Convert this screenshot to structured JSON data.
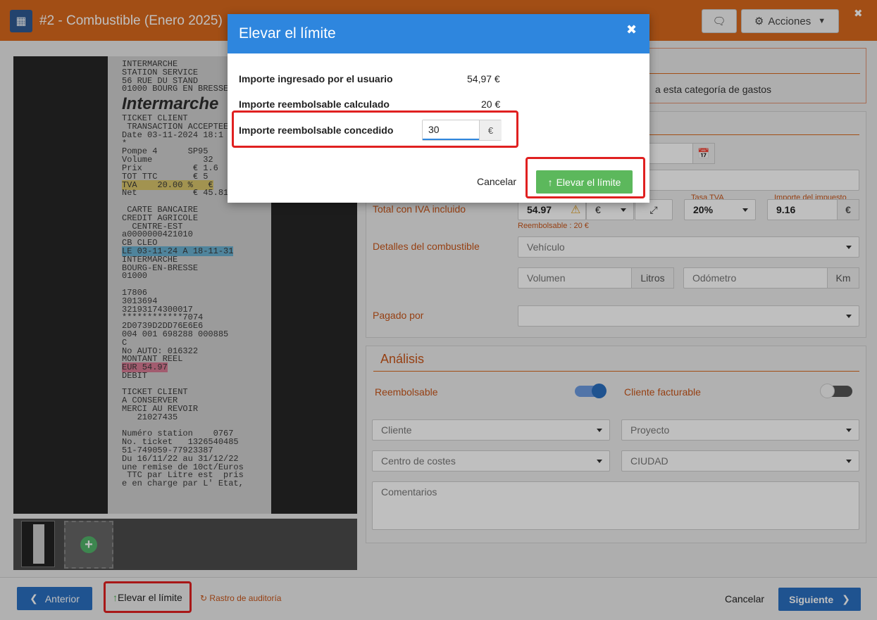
{
  "header": {
    "title": "#2 -  Combustible (Enero 2025)",
    "acciones_label": "Acciones",
    "chat_icon": "chat-icon",
    "close_glyph": "✖"
  },
  "receipt": {
    "lines_top": "INTERMARCHE\nSTATION SERVICE\n56 RUE DU STAND\n01000 BOURG EN BRESSE",
    "brand": "Intermarche",
    "lines_mid": "TICKET CLIENT\n TRANSACTION ACCEPTEE\nDate 03-11-2024 18:1\n*\nPompe 4      SP95\nVolume          32\nPrix          € 1.6\nTOT TTC       € 5",
    "tva_line": "TVA    20.00 %   €",
    "net_line": "Net           € 45.81",
    "lines_card": "\n CARTE BANCAIRE\nCREDIT AGRICOLE\n  CENTRE-EST\na0000000421010\nCB CLEO",
    "le_line": "LE 03-11-24 A 18-11-31",
    "lines_after": "INTERMARCHE\nBOURG-EN-BRESSE\n01000\n\n17806\n3013694\n32193174300017\n************7074\n2D0739D2DD76E6E6\n004 001 698288 000885\nC\nNo AUTO: 016322\nMONTANT REEL",
    "eur_line": "EUR 54.97",
    "lines_end": "DEBIT\n\nTICKET CLIENT\nA CONSERVER\nMERCI AU REVOIR\n   21027435\n\nNuméro station    0767\nNo. ticket   1326540485\n51-749059-77923387\nDu 16/11/22 au 31/12/22\nune remise de 10ct/Euros\n TTC par Litre est  pris\ne en charge par L' Etat,"
  },
  "banner": {
    "text": "a esta categoría de gastos"
  },
  "form": {
    "total_label": "Total con IVA incluido",
    "total_value": "54.97",
    "currency": "€",
    "reimbursable_note": "Reembolsable : 20 €",
    "tasa_label": "Tasa TVA",
    "tasa_value": "20%",
    "impuesto_label": "Importe del impuesto",
    "impuesto_value": "9.16",
    "combustible_label": "Detalles del combustible",
    "vehiculo_placeholder": "Vehículo",
    "volumen_placeholder": "Volumen",
    "litros": "Litros",
    "odometro_placeholder": "Odómetro",
    "km": "Km",
    "pagado_label": "Pagado por"
  },
  "analisis": {
    "title": "Análisis",
    "reembolsable_label": "Reembolsable",
    "reembolsable_on": true,
    "cliente_facturable_label": "Cliente facturable",
    "cliente_facturable_on": false,
    "cliente_placeholder": "Cliente",
    "proyecto_placeholder": "Proyecto",
    "centro_placeholder": "Centro de costes",
    "ciudad_placeholder": "CIUDAD",
    "comentarios_placeholder": "Comentarios"
  },
  "footer": {
    "anterior": "Anterior",
    "elevar": "Elevar el límite",
    "rastro": "Rastro de auditoría",
    "cancelar": "Cancelar",
    "siguiente": "Siguiente"
  },
  "modal": {
    "title": "Elevar el límite",
    "row1_label": "Importe ingresado por el usuario",
    "row1_value": "54,97 €",
    "row2_label": "Importe reembolsable calculado",
    "row2_value": "20 €",
    "row3_label": "Importe reembolsable concedido",
    "row3_input": "30",
    "row3_unit": "€",
    "cancel": "Cancelar",
    "submit": "Elevar el límite"
  },
  "colors": {
    "accent": "#d9681c",
    "primary": "#2a6fc0",
    "modal_head": "#2e86de",
    "success": "#5cb85c",
    "highlight": "#e02020"
  }
}
